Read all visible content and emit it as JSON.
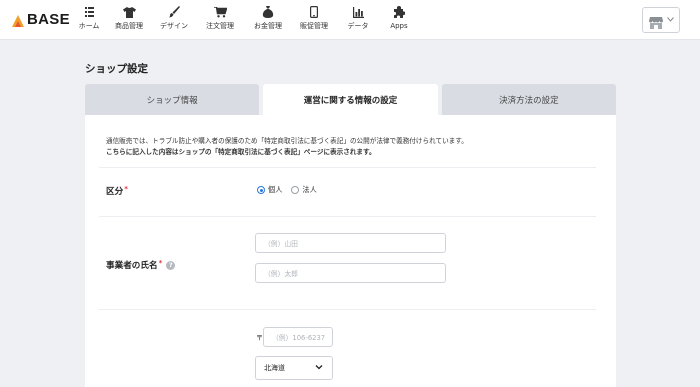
{
  "brand": {
    "logo_text": "BASE"
  },
  "nav": [
    {
      "label": "ホーム",
      "icon": "home-icon"
    },
    {
      "label": "商品管理",
      "icon": "shirt-icon"
    },
    {
      "label": "デザイン",
      "icon": "brush-icon"
    },
    {
      "label": "注文管理",
      "icon": "cart-icon"
    },
    {
      "label": "お金管理",
      "icon": "money-bag-icon"
    },
    {
      "label": "販促管理",
      "icon": "smartphone-icon"
    },
    {
      "label": "データ",
      "icon": "bar-chart-icon"
    },
    {
      "label": "Apps",
      "icon": "puzzle-icon"
    }
  ],
  "page": {
    "title": "ショップ設定"
  },
  "tabs": [
    {
      "label": "ショップ情報",
      "active": false
    },
    {
      "label": "運営に関する情報の設定",
      "active": true
    },
    {
      "label": "決済方法の設定",
      "active": false
    }
  ],
  "notice": {
    "line1": "通信販売では、トラブル防止や購入者の保護のため「特定商取引法に基づく表記」の公開が法律で義務付けられています。",
    "line2": "こちらに記入した内容はショップの「特定商取引法に基づく表記」ページに表示されます。"
  },
  "form": {
    "category": {
      "label": "区分",
      "required_mark": "*",
      "options": [
        {
          "label": "個人",
          "checked": true
        },
        {
          "label": "法人",
          "checked": false
        }
      ]
    },
    "owner_name": {
      "label": "事業者の氏名",
      "required_mark": "*",
      "help": "?",
      "last_name_placeholder": "（例）山田",
      "first_name_placeholder": "（例）太郎"
    },
    "address": {
      "postal_mark": "〒",
      "postal_placeholder": "（例）106-6237",
      "prefecture_value": "北海道"
    }
  },
  "colors": {
    "accent": "#2a78d9",
    "required": "#e5323e",
    "tab_inactive": "#d9dde3"
  }
}
